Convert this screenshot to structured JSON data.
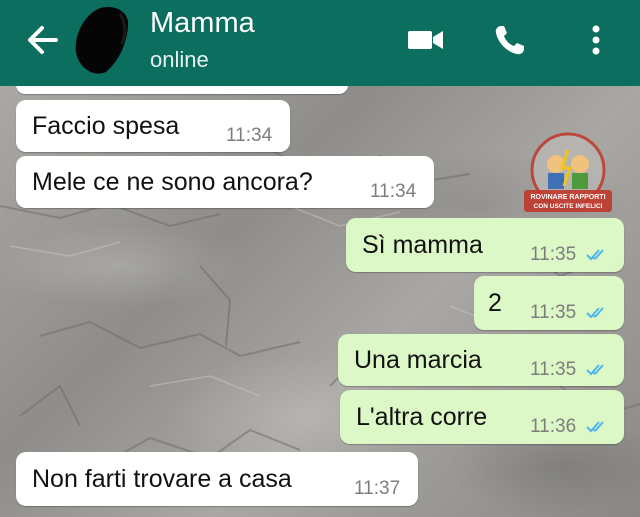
{
  "header": {
    "contact_name": "Mamma",
    "status": "online",
    "back_icon": "arrow-left-icon",
    "video_icon": "video-camera-icon",
    "call_icon": "phone-icon",
    "menu_icon": "more-vertical-icon",
    "background_color": "#0b6e5f"
  },
  "chat": {
    "incoming_color": "#ffffff",
    "outgoing_color": "#dcf8c6",
    "read_tick_color": "#4fb6ec",
    "messages": [
      {
        "direction": "in",
        "text": "Faccio spesa",
        "time": "11:34"
      },
      {
        "direction": "in",
        "text": "Mele ce ne sono ancora?",
        "time": "11:34"
      },
      {
        "direction": "out",
        "text": "Sì mamma",
        "time": "11:35",
        "status": "read"
      },
      {
        "direction": "out",
        "text": "2",
        "time": "11:35",
        "status": "read"
      },
      {
        "direction": "out",
        "text": "Una marcia",
        "time": "11:35",
        "status": "read"
      },
      {
        "direction": "out",
        "text": "L'altra corre",
        "time": "11:36",
        "status": "read"
      },
      {
        "direction": "in",
        "text": "Non farti trovare a casa",
        "time": "11:37"
      }
    ]
  },
  "watermark": {
    "line1": "ROVINARE RAPPORTI",
    "line2": "CON USCITE INFELICI"
  }
}
